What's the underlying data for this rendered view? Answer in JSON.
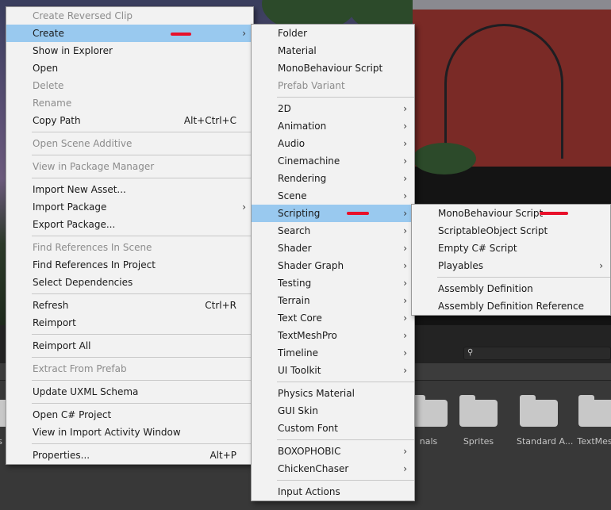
{
  "colors": {
    "menu_bg": "#f2f2f2",
    "highlight": "#99c9ef",
    "disabled_text": "#8c8c8c",
    "annotation_red": "#e8102a"
  },
  "main_menu": [
    {
      "label": "Create Reversed Clip",
      "disabled": true
    },
    {
      "label": "Create",
      "submenu": true,
      "highlight": true
    },
    {
      "label": "Show in Explorer"
    },
    {
      "label": "Open"
    },
    {
      "label": "Delete",
      "disabled": true
    },
    {
      "label": "Rename",
      "disabled": true
    },
    {
      "label": "Copy Path",
      "shortcut": "Alt+Ctrl+C"
    },
    {
      "separator": true
    },
    {
      "label": "Open Scene Additive",
      "disabled": true
    },
    {
      "separator": true
    },
    {
      "label": "View in Package Manager",
      "disabled": true
    },
    {
      "separator": true
    },
    {
      "label": "Import New Asset..."
    },
    {
      "label": "Import Package",
      "submenu": true
    },
    {
      "label": "Export Package..."
    },
    {
      "separator": true
    },
    {
      "label": "Find References In Scene",
      "disabled": true
    },
    {
      "label": "Find References In Project"
    },
    {
      "label": "Select Dependencies"
    },
    {
      "separator": true
    },
    {
      "label": "Refresh",
      "shortcut": "Ctrl+R"
    },
    {
      "label": "Reimport"
    },
    {
      "separator": true
    },
    {
      "label": "Reimport All"
    },
    {
      "separator": true
    },
    {
      "label": "Extract From Prefab",
      "disabled": true
    },
    {
      "separator": true
    },
    {
      "label": "Update UXML Schema"
    },
    {
      "separator": true
    },
    {
      "label": "Open C# Project"
    },
    {
      "label": "View in Import Activity Window"
    },
    {
      "separator": true
    },
    {
      "label": "Properties...",
      "shortcut": "Alt+P"
    }
  ],
  "create_menu": [
    {
      "label": "Folder"
    },
    {
      "label": "Material"
    },
    {
      "label": "MonoBehaviour Script"
    },
    {
      "label": "Prefab Variant",
      "disabled": true
    },
    {
      "separator": true
    },
    {
      "label": "2D",
      "submenu": true
    },
    {
      "label": "Animation",
      "submenu": true
    },
    {
      "label": "Audio",
      "submenu": true
    },
    {
      "label": "Cinemachine",
      "submenu": true
    },
    {
      "label": "Rendering",
      "submenu": true
    },
    {
      "label": "Scene",
      "submenu": true
    },
    {
      "label": "Scripting",
      "submenu": true,
      "highlight": true
    },
    {
      "label": "Search",
      "submenu": true
    },
    {
      "label": "Shader",
      "submenu": true
    },
    {
      "label": "Shader Graph",
      "submenu": true
    },
    {
      "label": "Testing",
      "submenu": true
    },
    {
      "label": "Terrain",
      "submenu": true
    },
    {
      "label": "Text Core",
      "submenu": true
    },
    {
      "label": "TextMeshPro",
      "submenu": true
    },
    {
      "label": "Timeline",
      "submenu": true
    },
    {
      "label": "UI Toolkit",
      "submenu": true
    },
    {
      "separator": true
    },
    {
      "label": "Physics Material"
    },
    {
      "label": "GUI Skin"
    },
    {
      "label": "Custom Font"
    },
    {
      "separator": true
    },
    {
      "label": "BOXOPHOBIC",
      "submenu": true
    },
    {
      "label": "ChickenChaser",
      "submenu": true
    },
    {
      "separator": true
    },
    {
      "label": "Input Actions"
    }
  ],
  "scripting_menu": [
    {
      "label": "MonoBehaviour Script"
    },
    {
      "label": "ScriptableObject Script"
    },
    {
      "label": "Empty C# Script"
    },
    {
      "label": "Playables",
      "submenu": true
    },
    {
      "separator": true
    },
    {
      "label": "Assembly Definition"
    },
    {
      "label": "Assembly Definition Reference"
    }
  ],
  "project_assets": [
    {
      "label": "ts",
      "icon": "folder-icon"
    },
    {
      "label": "nals",
      "icon": "folder-icon"
    },
    {
      "label": "Sprites",
      "icon": "folder-icon"
    },
    {
      "label": "Standard A...",
      "icon": "folder-icon"
    },
    {
      "label": "TextMesh",
      "icon": "folder-icon"
    }
  ],
  "search_icon": "search-icon",
  "submenu_arrow": "›"
}
